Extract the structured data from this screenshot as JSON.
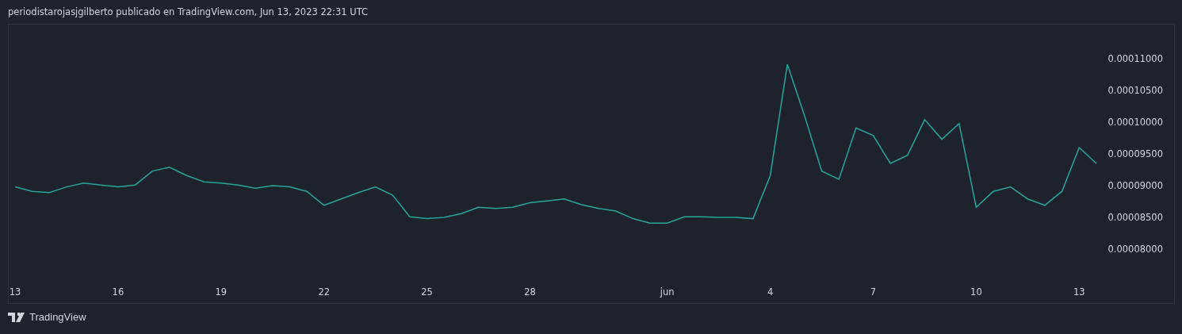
{
  "header": {
    "text": "periodistarojasjgilberto publicado en TradingView.com, Jun 13, 2023 22:31 UTC"
  },
  "chart": {
    "chart_data": {
      "type": "line",
      "categories": [
        "13",
        null,
        null,
        null,
        null,
        null,
        "16",
        null,
        null,
        null,
        null,
        null,
        "19",
        null,
        null,
        null,
        null,
        null,
        "22",
        null,
        null,
        null,
        null,
        null,
        "25",
        null,
        null,
        null,
        null,
        null,
        "28",
        null,
        null,
        null,
        null,
        null,
        null,
        null,
        "jun",
        null,
        null,
        null,
        null,
        null,
        "4",
        null,
        null,
        null,
        null,
        null,
        "7",
        null,
        null,
        null,
        null,
        null,
        "10",
        null,
        null,
        null,
        null,
        null,
        "13",
        null
      ],
      "series": [
        {
          "color": "#26a69a",
          "values": [
            8.98e-05,
            8.91e-05,
            8.89e-05,
            8.98e-05,
            9.04e-05,
            9.01e-05,
            8.98e-05,
            9.01e-05,
            9.23e-05,
            9.29e-05,
            9.16e-05,
            9.06e-05,
            9.04e-05,
            9.01e-05,
            8.96e-05,
            9e-05,
            8.98e-05,
            8.91e-05,
            8.69e-05,
            8.79e-05,
            8.89e-05,
            8.98e-05,
            8.85e-05,
            8.51e-05,
            8.48e-05,
            8.5e-05,
            8.56e-05,
            8.66e-05,
            8.64e-05,
            8.66e-05,
            8.73e-05,
            8.76e-05,
            8.79e-05,
            8.7e-05,
            8.64e-05,
            8.6e-05,
            8.48e-05,
            8.41e-05,
            8.41e-05,
            8.51e-05,
            8.51e-05,
            8.5e-05,
            8.5e-05,
            8.48e-05,
            9.16e-05,
            0.0001091,
            0.000101,
            9.23e-05,
            9.1e-05,
            9.91e-05,
            9.79e-05,
            9.35e-05,
            9.48e-05,
            0.0001004,
            9.73e-05,
            9.98e-05,
            8.66e-05,
            8.91e-05,
            8.98e-05,
            8.79e-05,
            8.69e-05,
            8.91e-05,
            9.6e-05,
            9.35e-05
          ]
        }
      ],
      "ylim": [
        7.15e-05,
        0.000115375
      ],
      "yticks": [
        {
          "value": 0.00011,
          "label": "0.00011000"
        },
        {
          "value": 0.000105,
          "label": "0.00010500"
        },
        {
          "value": 0.0001,
          "label": "0.00010000"
        },
        {
          "value": 9.5e-05,
          "label": "0.00009500"
        },
        {
          "value": 9e-05,
          "label": "0.00009000"
        },
        {
          "value": 8.5e-05,
          "label": "0.00008500"
        },
        {
          "value": 8e-05,
          "label": "0.00008000"
        }
      ]
    }
  },
  "footer": {
    "logo_text": "TradingView"
  }
}
